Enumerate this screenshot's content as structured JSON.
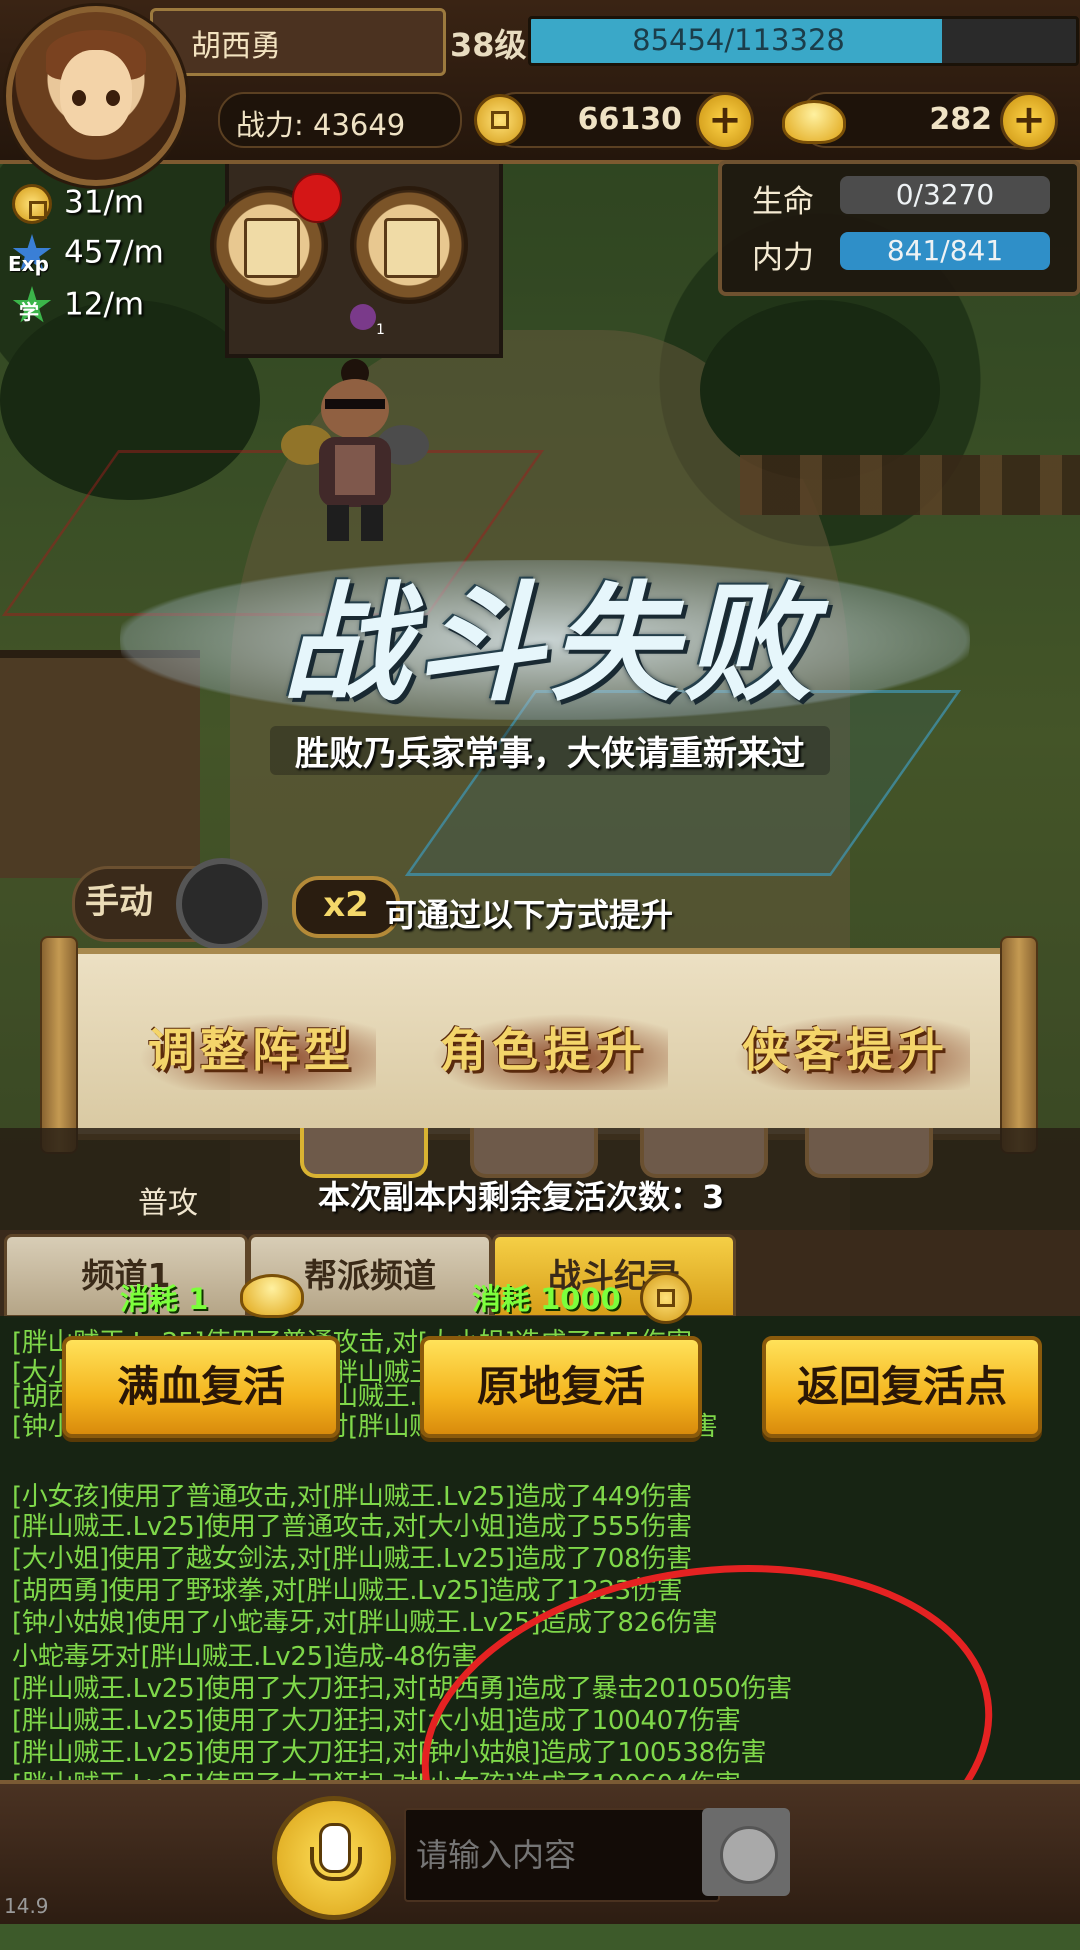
{
  "player": {
    "name": "胡西勇",
    "level": "38级",
    "exp_text": "85454/113328",
    "exp_fraction": 0.754,
    "power": "战力: 43649",
    "coins": "66130",
    "ingots": "282"
  },
  "stats": {
    "hp_label": "生命",
    "hp_value": "0/3270",
    "mp_label": "内力",
    "mp_value": "841/841",
    "mp_color": "#2f8fc8"
  },
  "rates": {
    "coin_rate": "31/m",
    "exp_label": "Exp",
    "exp_rate": "457/m",
    "learn_label": "学",
    "learn_rate": "12/m"
  },
  "badge_count": "1",
  "defeat": {
    "title": "战斗失败",
    "subtitle": "胜败乃兵家常事，大侠请重新来过",
    "hint": "可通过以下方式提升",
    "options": [
      "调整阵型",
      "角色提升",
      "侠客提升"
    ]
  },
  "controls": {
    "manual": "手动",
    "speed": "x2"
  },
  "skills": {
    "normal_attack": "普攻",
    "revive_remaining": "本次副本内剩余复活次数：3"
  },
  "tabs": [
    "频道1",
    "帮派频道",
    "战斗纪录"
  ],
  "revive": {
    "full_cost": "消耗 1",
    "inplace_cost": "消耗 1000",
    "full_label": "满血复活",
    "inplace_label": "原地复活",
    "return_label": "返回复活点"
  },
  "log_lines": [
    "[胖山贼王.Lv25]使用了普通攻击,对[大小姐]造成了555伤害",
    "[大小姐]使用了越女剑法,对[胖山贼王.Lv25]造成了708伤害",
    "[胡西勇]使用了野球拳,对[胖山贼王.Lv25]造成了1223伤害",
    "[钟小姑娘]使用了普通攻击,对[胖山贼王.Lv25]造成了688伤害",
    "[小女孩]使用了普通攻击,对[胖山贼王.Lv25]造成了449伤害",
    "[胖山贼王.Lv25]使用了普通攻击,对[大小姐]造成了555伤害",
    "[大小姐]使用了越女剑法,对[胖山贼王.Lv25]造成了708伤害",
    "[胡西勇]使用了野球拳,对[胖山贼王.Lv25]造成了1223伤害",
    "[钟小姑娘]使用了小蛇毒牙,对[胖山贼王.Lv25]造成了826伤害",
    "小蛇毒牙对[胖山贼王.Lv25]造成-48伤害",
    "[胖山贼王.Lv25]使用了大刀狂扫,对[胡西勇]造成了暴击201050伤害",
    "[胖山贼王.Lv25]使用了大刀狂扫,对[大小姐]造成了100407伤害",
    "[胖山贼王.Lv25]使用了大刀狂扫,对[钟小姑娘]造成了100538伤害",
    "[胖山贼王.Lv25]使用了大刀狂扫,对[小女孩]造成了100604伤害"
  ],
  "chat": {
    "placeholder": "请输入内容"
  },
  "version": "14.9",
  "colors": {
    "exp_bar": "#3aa8c8",
    "revive_button": "#f4b41e",
    "annotation_ring": "#e52222"
  }
}
